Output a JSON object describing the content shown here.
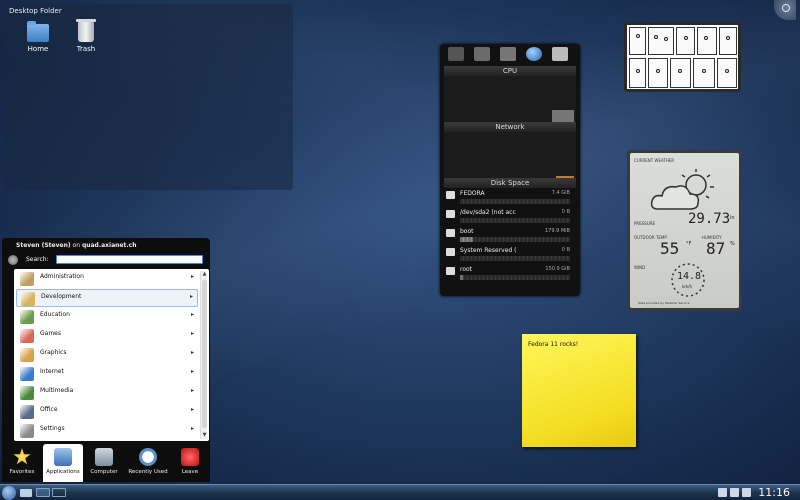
{
  "desktop_folder": {
    "title": "Desktop Folder",
    "icons": [
      {
        "label": "Home",
        "icon": "folder-icon"
      },
      {
        "label": "Trash",
        "icon": "trash-icon"
      }
    ]
  },
  "system_monitor": {
    "tabs": [
      "hardware-icon",
      "memory-icon",
      "network-icon",
      "globe-icon",
      "disk-icon"
    ],
    "sections": {
      "cpu": "CPU",
      "network": "Network",
      "disk_space": "Disk Space"
    },
    "disks": [
      {
        "name": "FEDORA",
        "size": "7.4 GiB",
        "used_fraction": 0.0
      },
      {
        "name": "/dev/sda2 (not acc",
        "size": "0 B",
        "used_fraction": 0.0
      },
      {
        "name": "boot",
        "size": "179.9 MiB",
        "used_fraction": 0.12
      },
      {
        "name": "System Reserved (",
        "size": "0 B",
        "used_fraction": 0.0
      },
      {
        "name": "root",
        "size": "150.9 GiB",
        "used_fraction": 0.03
      }
    ]
  },
  "weather": {
    "current_label": "CURRENT WEATHER",
    "pressure_label": "PRESSURE",
    "pressure_value": "29.73",
    "pressure_unit": "in",
    "outdoor_label": "OUTDOOR TEMP",
    "outdoor_value": "55",
    "outdoor_unit": "°F",
    "humidity_label": "HUMIDITY",
    "humidity_value": "87",
    "humidity_unit": "%",
    "wind_label": "WIND",
    "wind_value": "14.8",
    "wind_unit": "km/h",
    "footer": "Data provided by Weather Service"
  },
  "note": {
    "text": "Fedora 11 rocks!"
  },
  "kickoff": {
    "user_name": "Steven (Steven)",
    "user_host_prefix": "on",
    "host": "quad.axianet.ch",
    "search_label": "Search:",
    "search_value": "",
    "categories": [
      {
        "label": "Administration",
        "icon": "tools-icon",
        "color": "#c0a060"
      },
      {
        "label": "Development",
        "icon": "hammer-icon",
        "color": "#d9b45a"
      },
      {
        "label": "Education",
        "icon": "blackboard-icon",
        "color": "#6a9c4c"
      },
      {
        "label": "Games",
        "icon": "cards-icon",
        "color": "#d86a5a"
      },
      {
        "label": "Graphics",
        "icon": "palette-icon",
        "color": "#d9a14a"
      },
      {
        "label": "Internet",
        "icon": "globe-icon",
        "color": "#3a7ad0"
      },
      {
        "label": "Multimedia",
        "icon": "film-icon",
        "color": "#4a8a3a"
      },
      {
        "label": "Office",
        "icon": "office-icon",
        "color": "#5a6a8a"
      },
      {
        "label": "Settings",
        "icon": "settings-icon",
        "color": "#8a8a8a"
      }
    ],
    "selected_category": "Development",
    "tabs": [
      {
        "label": "Favorites",
        "icon": "star-icon"
      },
      {
        "label": "Applications",
        "icon": "applications-icon"
      },
      {
        "label": "Computer",
        "icon": "computer-icon"
      },
      {
        "label": "Recently Used",
        "icon": "clock-icon"
      },
      {
        "label": "Leave",
        "icon": "power-icon"
      }
    ],
    "active_tab": "Applications"
  },
  "panel": {
    "clock": "11:16",
    "accent": "#2e62a6"
  }
}
